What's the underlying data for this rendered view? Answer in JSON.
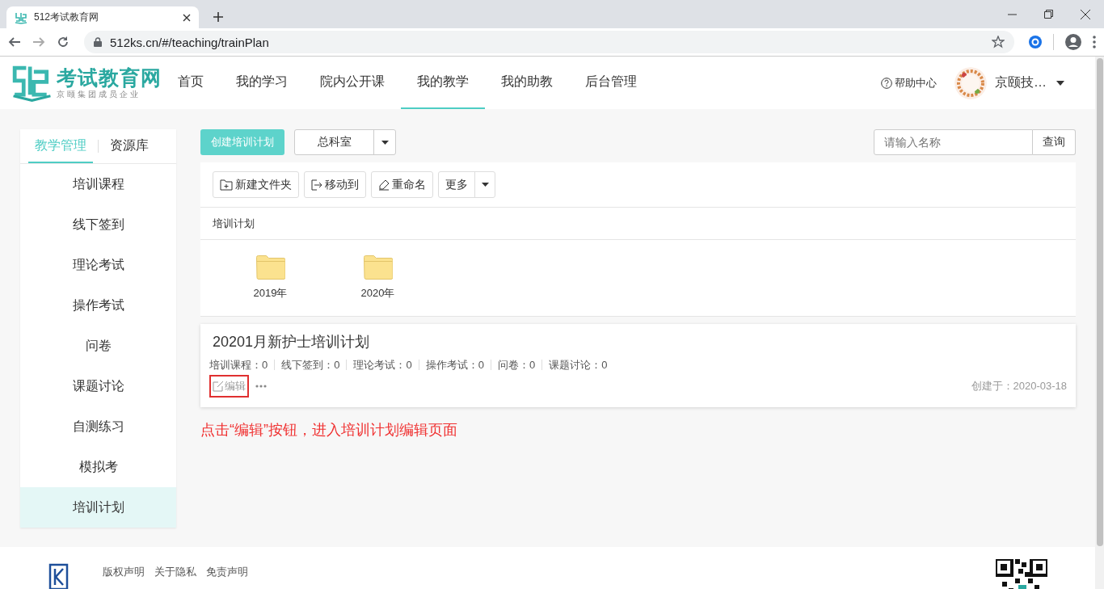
{
  "browser": {
    "tab_title": "512考试教育网",
    "url": "512ks.cn/#/teaching/trainPlan"
  },
  "header": {
    "logo": {
      "name": "考试教育网",
      "slogan": "京颐集团成员企业"
    },
    "nav": [
      {
        "label": "首页",
        "selected": false
      },
      {
        "label": "我的学习",
        "selected": false
      },
      {
        "label": "院内公开课",
        "selected": false
      },
      {
        "label": "我的教学",
        "selected": true
      },
      {
        "label": "我的助教",
        "selected": false
      },
      {
        "label": "后台管理",
        "selected": false
      }
    ],
    "help": "帮助中心",
    "user": "京颐技…"
  },
  "sidebar": {
    "tabs": [
      {
        "label": "教学管理",
        "selected": true
      },
      {
        "label": "资源库",
        "selected": false
      }
    ],
    "items": [
      {
        "label": "培训课程",
        "selected": false
      },
      {
        "label": "线下签到",
        "selected": false
      },
      {
        "label": "理论考试",
        "selected": false
      },
      {
        "label": "操作考试",
        "selected": false
      },
      {
        "label": "问卷",
        "selected": false
      },
      {
        "label": "课题讨论",
        "selected": false
      },
      {
        "label": "自测练习",
        "selected": false
      },
      {
        "label": "模拟考",
        "selected": false
      },
      {
        "label": "培训计划",
        "selected": true
      }
    ]
  },
  "toolbar": {
    "create_button": "创建培训计划",
    "department": "总科室",
    "search": {
      "placeholder": "请输入名称"
    },
    "query_button": "查询"
  },
  "file_actions": [
    {
      "label": "新建文件夹",
      "kind": "new-folder"
    },
    {
      "label": "移动到",
      "kind": "move"
    },
    {
      "label": "重命名",
      "kind": "rename"
    },
    {
      "label": "更多",
      "kind": "more"
    }
  ],
  "breadcrumb": "培训计划",
  "folders": [
    {
      "label": "2019年"
    },
    {
      "label": "2020年"
    }
  ],
  "plan": {
    "title": "20201月新护士培训计划",
    "stats": [
      "培训课程：0",
      "线下签到：0",
      "理论考试：0",
      "操作考试：0",
      "问卷：0",
      "课题讨论：0"
    ],
    "edit": "编辑",
    "edit_highlighted": true,
    "created": "创建于：2020-03-18"
  },
  "annotation": "点击“编辑”按钮，进入培训计划编辑页面",
  "footer": {
    "links": [
      "版权声明",
      "关于隐私",
      "免责声明"
    ]
  }
}
